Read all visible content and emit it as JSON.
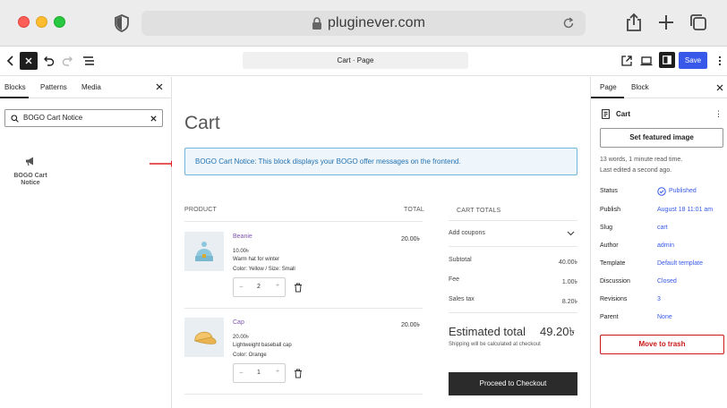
{
  "browser": {
    "url": "pluginever.com"
  },
  "toolbar": {
    "document_title": "Cart · Page",
    "save_label": "Save"
  },
  "inserter": {
    "tabs": [
      "Blocks",
      "Patterns",
      "Media"
    ],
    "search_value": "BOGO Cart Notice",
    "result": {
      "label": "BOGO Cart Notice",
      "icon": "megaphone-icon"
    }
  },
  "canvas": {
    "heading": "Cart",
    "notice": "BOGO Cart Notice: This block displays your BOGO offer messages on the frontend.",
    "columns": {
      "product": "PRODUCT",
      "total": "TOTAL"
    },
    "items": [
      {
        "name": "Beanie",
        "price": "10.00৳",
        "description": "Warm hat for winter",
        "variation": "Color: Yellow / Size: Small",
        "quantity": "2",
        "total": "20.00৳"
      },
      {
        "name": "Cap",
        "price": "20.00৳",
        "description": "Lightweight baseball cap",
        "variation": "Color: Orange",
        "quantity": "1",
        "total": "20.00৳"
      }
    ],
    "totals": {
      "title": "CART TOTALS",
      "coupons": "Add coupons",
      "rows": [
        {
          "label": "Subtotal",
          "value": "40.00৳"
        },
        {
          "label": "Fee",
          "value": "1.00৳"
        },
        {
          "label": "Sales tax",
          "value": "8.20৳"
        }
      ],
      "estimated_label": "Estimated total",
      "estimated_value": "49.20৳",
      "shipping_note": "Shipping will be calculated at checkout",
      "checkout_label": "Proceed to Checkout"
    }
  },
  "settings": {
    "tabs": [
      "Page",
      "Block"
    ],
    "doc_title": "Cart",
    "featured_image_label": "Set featured image",
    "meta_line1": "13 words, 1 minute read time.",
    "meta_line2": "Last edited a second ago.",
    "rows": [
      {
        "label": "Status",
        "value": "Published"
      },
      {
        "label": "Publish",
        "value": "August 18 11:01 am"
      },
      {
        "label": "Slug",
        "value": "cart"
      },
      {
        "label": "Author",
        "value": "admin"
      },
      {
        "label": "Template",
        "value": "Default template"
      },
      {
        "label": "Discussion",
        "value": "Closed"
      },
      {
        "label": "Revisions",
        "value": "3"
      },
      {
        "label": "Parent",
        "value": "None"
      }
    ],
    "trash_label": "Move to trash"
  },
  "colors": {
    "accent": "#3858e9",
    "notice_bg": "#eef6fb",
    "danger": "#cc1818",
    "product_link": "#7f54b3"
  }
}
